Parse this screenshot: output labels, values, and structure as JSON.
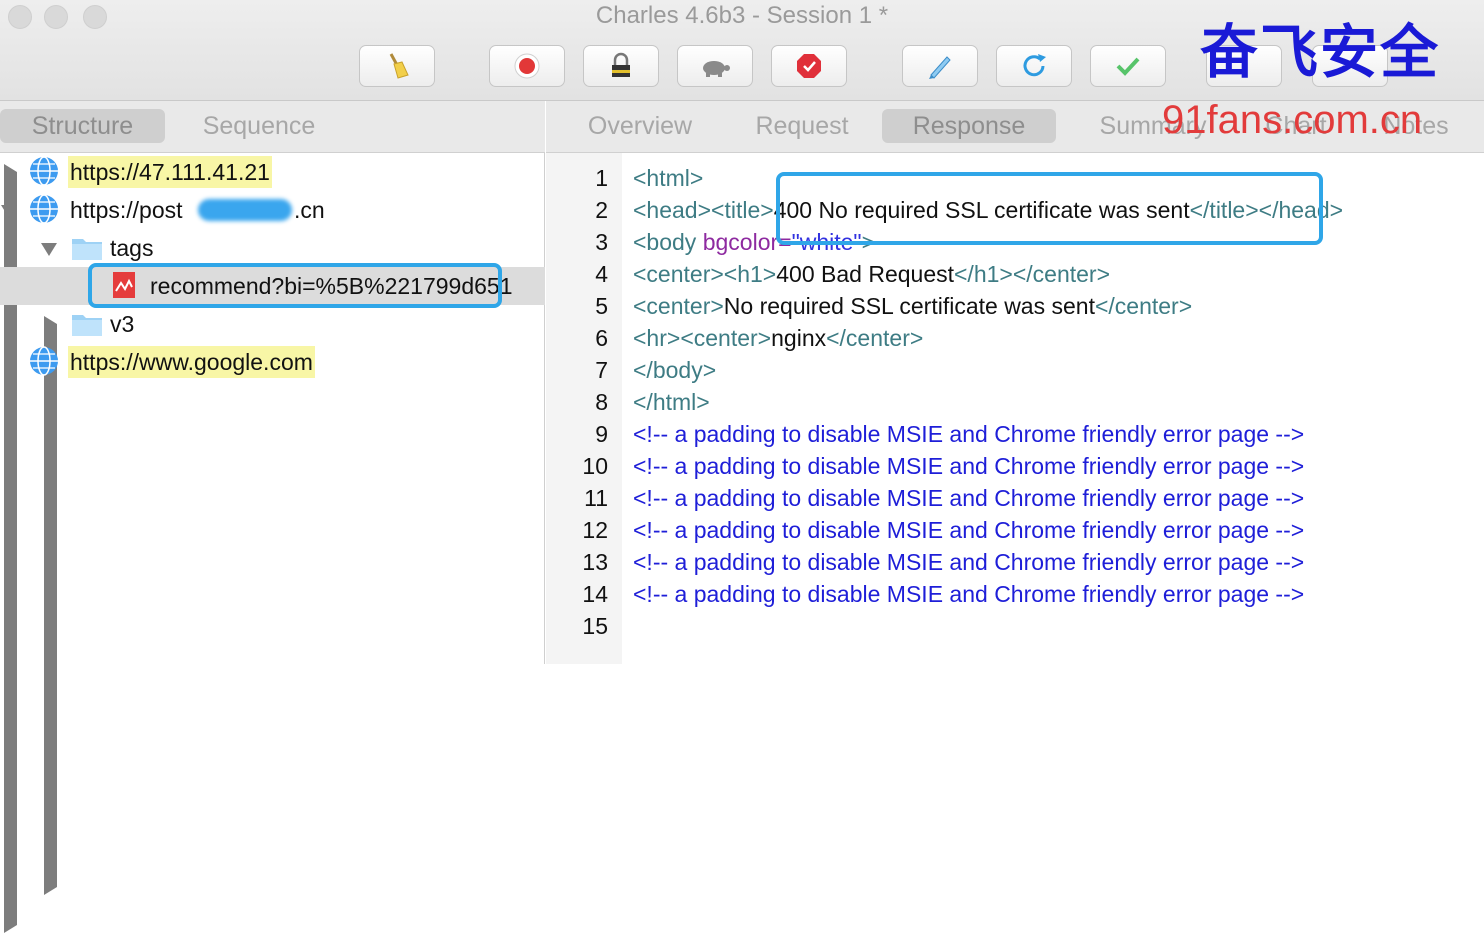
{
  "window": {
    "title": "Charles 4.6b3 - Session 1 *"
  },
  "watermark": {
    "cn": "奋飞安全",
    "url": "91fans.com.cn"
  },
  "toolbar": {
    "buttons": [
      {
        "name": "broom-icon"
      },
      {
        "name": "record-icon"
      },
      {
        "name": "lock-icon"
      },
      {
        "name": "turtle-icon"
      },
      {
        "name": "stop-icon"
      },
      {
        "name": "pen-icon"
      },
      {
        "name": "refresh-icon"
      },
      {
        "name": "check-icon"
      }
    ]
  },
  "left": {
    "tabs": [
      "Structure",
      "Sequence"
    ],
    "active_tab": "Structure",
    "tree": [
      {
        "label": "https://47.111.41.21",
        "expanded": false,
        "highlight": true
      },
      {
        "label_prefix": "https://post",
        "label_suffix": ".cn",
        "expanded": true
      },
      {
        "label": "tags",
        "expanded": true
      },
      {
        "label": "recommend?bi=%5B%221799d651",
        "selected": true
      },
      {
        "label": "v3",
        "expanded": false
      },
      {
        "label": "https://www.google.com",
        "expanded": false,
        "highlight": true
      }
    ]
  },
  "right": {
    "tabs": [
      "Overview",
      "Request",
      "Response",
      "Summary",
      "Chart",
      "Notes"
    ],
    "active_tab": "Response",
    "line_numbers": [
      "1",
      "2",
      "3",
      "4",
      "5",
      "6",
      "7",
      "8",
      "9",
      "10",
      "11",
      "12",
      "13",
      "14",
      "15"
    ],
    "code": {
      "l1": {
        "t1": "<html>"
      },
      "l2": {
        "t1": "<head>",
        "t2": "<title>",
        "text": "400 No required SSL certificate was sent",
        "t3": "</title>",
        "t4": "</head>"
      },
      "l3": {
        "t1": "<body ",
        "attr": "bgcolor",
        "eq": "=",
        "val": "\"white\"",
        "t2": ">"
      },
      "l4": {
        "t1": "<center>",
        "t2": "<h1>",
        "text": "400 Bad Request",
        "t3": "</h1>",
        "t4": "</center>"
      },
      "l5": {
        "t1": "<center>",
        "text": "No required SSL certificate was sent",
        "t2": "</center>"
      },
      "l6": {
        "t1": "<hr>",
        "t2": "<center>",
        "text": "nginx",
        "t3": "</center>"
      },
      "l7": {
        "t1": "</body>"
      },
      "l8": {
        "t1": "</html>"
      },
      "comment": "<!-- a padding to disable MSIE and Chrome friendly error page -->"
    }
  },
  "colors": {
    "accent_box": "#2fa6e8",
    "highlight": "#f8f6a6",
    "comment": "#1e1ed8"
  }
}
